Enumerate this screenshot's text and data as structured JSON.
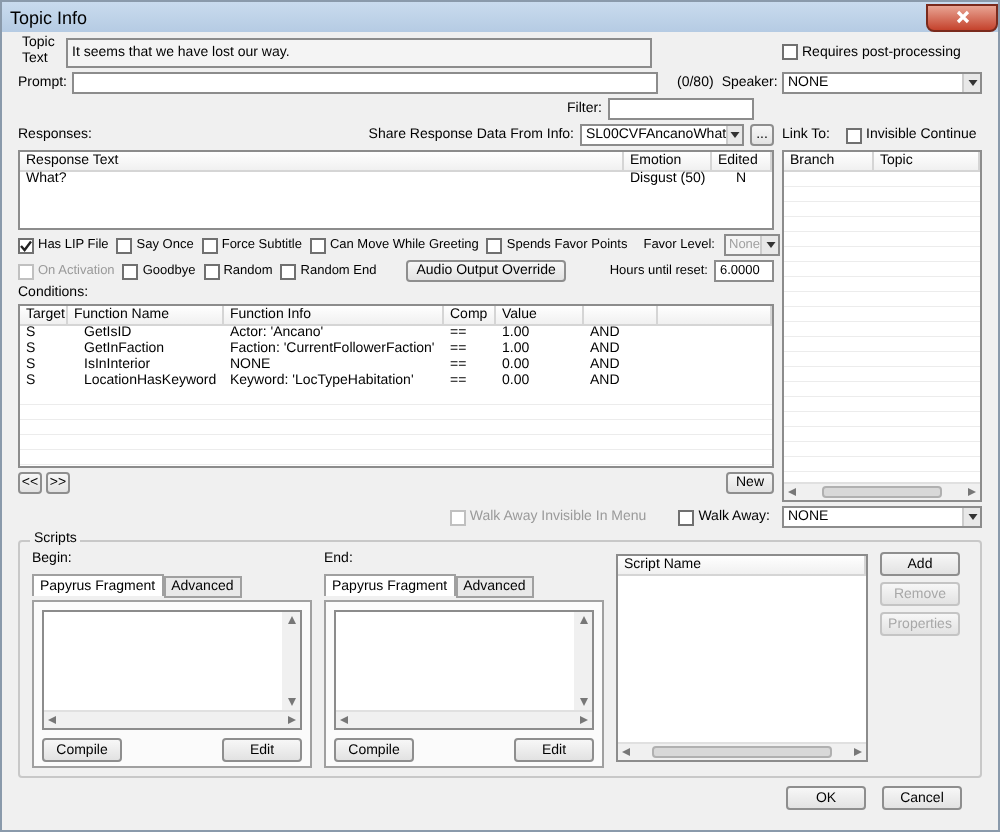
{
  "window": {
    "title": "Topic Info"
  },
  "topic_text": {
    "label": "Topic Text",
    "value": "It seems that we have lost our way."
  },
  "requires_post_processing": {
    "label": "Requires post-processing",
    "checked": false
  },
  "prompt": {
    "label": "Prompt:",
    "counter": "(0/80)"
  },
  "speaker": {
    "label": "Speaker:",
    "value": "NONE"
  },
  "filter": {
    "label": "Filter:"
  },
  "responses": {
    "label": "Responses:",
    "columns": [
      "Response Text",
      "Emotion",
      "Edited"
    ],
    "rows": [
      {
        "text": "What?",
        "emotion": "Disgust (50)",
        "edited": "N"
      }
    ]
  },
  "share_response": {
    "label": "Share Response Data From Info:",
    "value": "SL00CVFAncanoWhat",
    "button": "..."
  },
  "link_to": {
    "label": "Link To:",
    "invisible_continue": {
      "label": "Invisible Continue",
      "checked": false
    },
    "columns": [
      "Branch",
      "Topic"
    ]
  },
  "flags": [
    [
      {
        "label": "Has LIP File",
        "checked": true,
        "disabled": false
      },
      {
        "label": "Say Once",
        "checked": false,
        "disabled": false
      },
      {
        "label": "Force Subtitle",
        "checked": false,
        "disabled": false
      },
      {
        "label": "Can Move While Greeting",
        "checked": false,
        "disabled": false
      },
      {
        "label": "Spends Favor Points",
        "checked": false,
        "disabled": false
      }
    ],
    [
      {
        "label": "On Activation",
        "checked": false,
        "disabled": true
      },
      {
        "label": "Goodbye",
        "checked": false,
        "disabled": false
      },
      {
        "label": "Random",
        "checked": false,
        "disabled": false
      },
      {
        "label": "Random End",
        "checked": false,
        "disabled": false
      }
    ]
  ],
  "favor_level": {
    "label": "Favor Level:",
    "value": "None",
    "disabled": true
  },
  "audio_output_override": {
    "label": "Audio Output Override"
  },
  "hours_until_reset": {
    "label": "Hours until reset:",
    "value": "6.0000"
  },
  "conditions": {
    "label": "Conditions:",
    "columns": [
      "Target",
      "Function Name",
      "Function Info",
      "Comp",
      "Value"
    ],
    "rows": [
      {
        "target": "S",
        "function": "GetIsID",
        "info": "Actor: 'Ancano'",
        "comp": "==",
        "value": "1.00",
        "column_6": "AND"
      },
      {
        "target": "S",
        "function": "GetInFaction",
        "info": "Faction: 'CurrentFollowerFaction'",
        "comp": "==",
        "value": "1.00",
        "column_6": "AND"
      },
      {
        "target": "S",
        "function": "IsInInterior",
        "info": "NONE",
        "comp": "==",
        "value": "0.00",
        "column_6": "AND"
      },
      {
        "target": "S",
        "function": "LocationHasKeyword",
        "info": "Keyword: 'LocTypeHabitation'",
        "comp": "==",
        "value": "0.00",
        "column_6": "AND"
      }
    ]
  },
  "nav_buttons": [
    "<<",
    ">>"
  ],
  "new_button": "New",
  "walk_away_invisible": {
    "label": "Walk Away Invisible In Menu",
    "checked": false,
    "disabled": true
  },
  "walk_away": {
    "label": "Walk Away:",
    "checked": false,
    "value": "NONE"
  },
  "scripts": {
    "title": "Scripts",
    "fragments": [
      {
        "label": "Begin:",
        "tabs": [
          {
            "label": "Papyrus Fragment",
            "selected": true
          },
          {
            "label": "Advanced",
            "selected": false
          }
        ],
        "buttons": [
          "Compile",
          "Edit"
        ]
      },
      {
        "label": "End:",
        "tabs": [
          {
            "label": "Papyrus Fragment",
            "selected": true
          },
          {
            "label": "Advanced",
            "selected": false
          }
        ],
        "buttons": [
          "Compile",
          "Edit"
        ]
      }
    ],
    "list_header": "Script Name",
    "buttons": [
      {
        "label": "Add",
        "disabled": false
      },
      {
        "label": "Remove",
        "disabled": true
      },
      {
        "label": "Properties",
        "disabled": true
      }
    ]
  },
  "dialog_buttons": [
    "OK",
    "Cancel"
  ]
}
